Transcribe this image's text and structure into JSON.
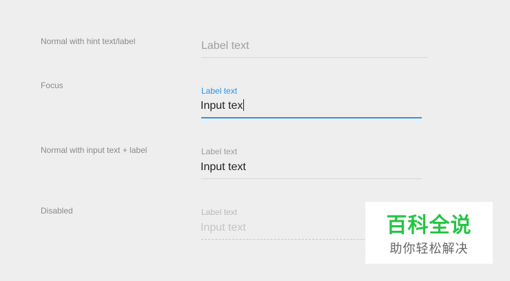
{
  "rows": [
    {
      "label": "Normal with hint text/label",
      "hint": "Label text"
    },
    {
      "label": "Focus",
      "floating_label": "Label text",
      "value": "Input tex"
    },
    {
      "label": "Normal with input text + label",
      "floating_label": "Label text",
      "value": "Input text"
    },
    {
      "label": "Disabled",
      "floating_label": "Label text",
      "value": "Input text"
    }
  ],
  "colors": {
    "background": "#eeeeee",
    "accent": "#2196f3",
    "watermark_green": "#28c445"
  },
  "watermark": {
    "title": "百科全说",
    "subtitle": "助你轻松解决"
  }
}
